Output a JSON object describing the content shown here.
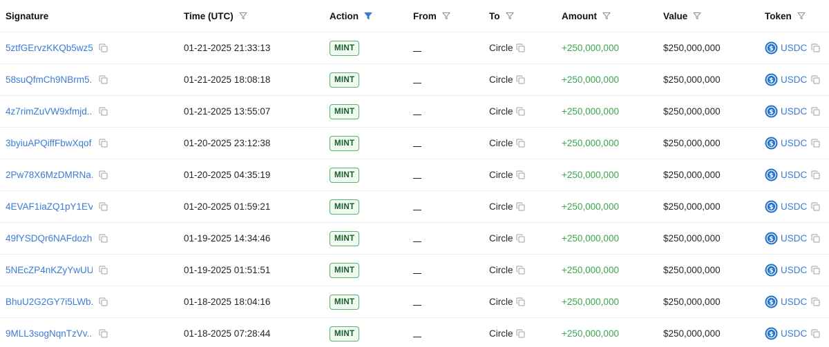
{
  "headers": {
    "signature": "Signature",
    "time": "Time (UTC)",
    "action": "Action",
    "from": "From",
    "to": "To",
    "amount": "Amount",
    "value": "Value",
    "token": "Token"
  },
  "colors": {
    "link": "#3a7bd5",
    "amount": "#3aa54b",
    "badge_border": "#58b36a",
    "badge_bg": "#eef9f0",
    "filter_active": "#3a7bd5",
    "filter_inactive": "#8a8f98",
    "usdc_blue": "#2775ca"
  },
  "rows": [
    {
      "signature": "5ztfGErvzKKQb5wz5...",
      "time": "01-21-2025 21:33:13",
      "action": "MINT",
      "from": "",
      "to": "Circle",
      "amount": "+250,000,000",
      "value": "$250,000,000",
      "token": "USDC"
    },
    {
      "signature": "58suQfmCh9NBrm5...",
      "time": "01-21-2025 18:08:18",
      "action": "MINT",
      "from": "",
      "to": "Circle",
      "amount": "+250,000,000",
      "value": "$250,000,000",
      "token": "USDC"
    },
    {
      "signature": "4z7rimZuVW9xfmjd...",
      "time": "01-21-2025 13:55:07",
      "action": "MINT",
      "from": "",
      "to": "Circle",
      "amount": "+250,000,000",
      "value": "$250,000,000",
      "token": "USDC"
    },
    {
      "signature": "3byiuAPQiffFbwXqof...",
      "time": "01-20-2025 23:12:38",
      "action": "MINT",
      "from": "",
      "to": "Circle",
      "amount": "+250,000,000",
      "value": "$250,000,000",
      "token": "USDC"
    },
    {
      "signature": "2Pw78X6MzDMRNa...",
      "time": "01-20-2025 04:35:19",
      "action": "MINT",
      "from": "",
      "to": "Circle",
      "amount": "+250,000,000",
      "value": "$250,000,000",
      "token": "USDC"
    },
    {
      "signature": "4EVAF1iaZQ1pY1EV...",
      "time": "01-20-2025 01:59:21",
      "action": "MINT",
      "from": "",
      "to": "Circle",
      "amount": "+250,000,000",
      "value": "$250,000,000",
      "token": "USDC"
    },
    {
      "signature": "49fYSDQr6NAFdozh...",
      "time": "01-19-2025 14:34:46",
      "action": "MINT",
      "from": "",
      "to": "Circle",
      "amount": "+250,000,000",
      "value": "$250,000,000",
      "token": "USDC"
    },
    {
      "signature": "5NEcZP4nKZyYwUU...",
      "time": "01-19-2025 01:51:51",
      "action": "MINT",
      "from": "",
      "to": "Circle",
      "amount": "+250,000,000",
      "value": "$250,000,000",
      "token": "USDC"
    },
    {
      "signature": "BhuU2G2GY7i5LWb...",
      "time": "01-18-2025 18:04:16",
      "action": "MINT",
      "from": "",
      "to": "Circle",
      "amount": "+250,000,000",
      "value": "$250,000,000",
      "token": "USDC"
    },
    {
      "signature": "9MLL3sogNqnTzVv...",
      "time": "01-18-2025 07:28:44",
      "action": "MINT",
      "from": "",
      "to": "Circle",
      "amount": "+250,000,000",
      "value": "$250,000,000",
      "token": "USDC"
    }
  ]
}
